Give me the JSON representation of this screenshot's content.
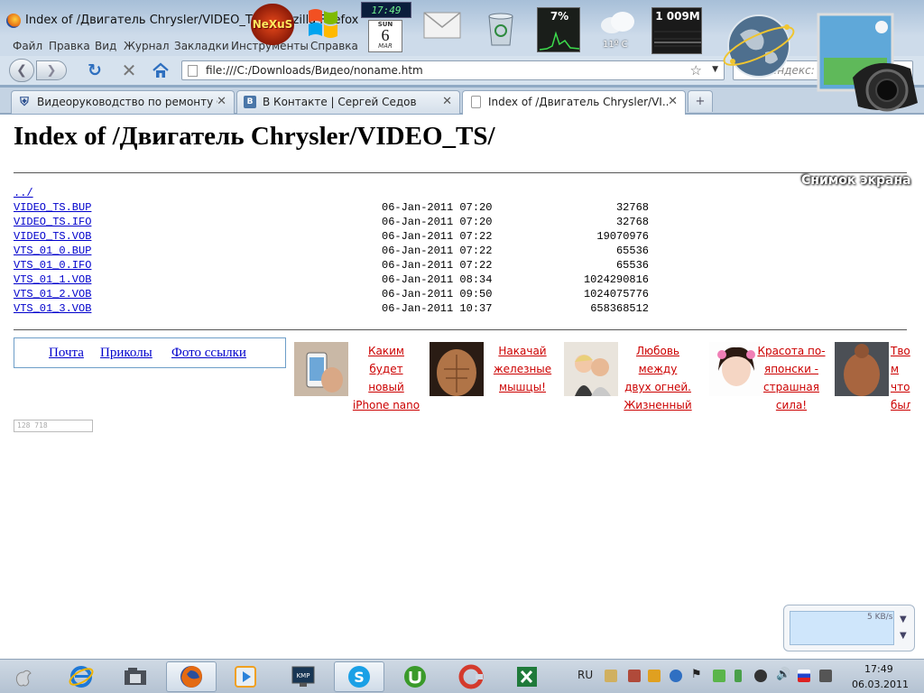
{
  "window": {
    "title": "Index of /Двигатель Chrysler/VIDEO_TS/ - Mozilla Firefox"
  },
  "menu": [
    "Файл",
    "Правка",
    "Вид",
    "Журнал",
    "Закладки",
    "Инструменты",
    "Справка"
  ],
  "nav": {
    "url": "file:///C:/Downloads/Видео/noname.htm",
    "search_placeholder": "Яндекс: Поиск"
  },
  "tabs": [
    {
      "label": "Видеоруководство по ремонту Ch...",
      "icon": "shield-icon",
      "active": false
    },
    {
      "label": "В Контакте | Сергей Седов",
      "icon": "vk-icon",
      "active": false
    },
    {
      "label": "Index of /Двигатель Chrysler/VI...",
      "icon": "page-icon",
      "active": true
    }
  ],
  "page": {
    "heading": "Index of /Двигатель Chrysler/VIDEO_TS/",
    "parent_link": "../",
    "files": [
      {
        "name": "VIDEO_TS.BUP",
        "date": "06-Jan-2011 07:20",
        "size": "32768"
      },
      {
        "name": "VIDEO_TS.IFO",
        "date": "06-Jan-2011 07:20",
        "size": "32768"
      },
      {
        "name": "VIDEO_TS.VOB",
        "date": "06-Jan-2011 07:22",
        "size": "19070976"
      },
      {
        "name": "VTS_01_0.BUP",
        "date": "06-Jan-2011 07:22",
        "size": "65536"
      },
      {
        "name": "VTS_01_0.IFO",
        "date": "06-Jan-2011 07:22",
        "size": "65536"
      },
      {
        "name": "VTS_01_1.VOB",
        "date": "06-Jan-2011 08:34",
        "size": "1024290816"
      },
      {
        "name": "VTS_01_2.VOB",
        "date": "06-Jan-2011 09:50",
        "size": "1024075776"
      },
      {
        "name": "VTS_01_3.VOB",
        "date": "06-Jan-2011 10:37",
        "size": "658368512"
      }
    ],
    "links": [
      "Почта",
      "Приколы",
      "Фото ссылки"
    ],
    "ads": [
      {
        "text": "Каким будет новый iPhone nano"
      },
      {
        "text": "Накачай железные мышцы!"
      },
      {
        "text": "Любовь между двух огней. Жизненный"
      },
      {
        "text": "Красота по-японски - страшная сила!"
      },
      {
        "text": "Тво м что был"
      }
    ],
    "counter": "128 718"
  },
  "overlay": {
    "screenshot_label": "Снимок экрана",
    "speed": "5 KB/s"
  },
  "gadgets": {
    "nexus": "NeXuS",
    "clock": "17:49",
    "cal_dow": "SUN",
    "cal_day": "6",
    "cal_month": "MAR",
    "cpu": "7%",
    "weather_temp": "11º C",
    "memory": "1 009M"
  },
  "taskbar": {
    "lang": "RU",
    "time": "17:49",
    "date": "06.03.2011"
  }
}
